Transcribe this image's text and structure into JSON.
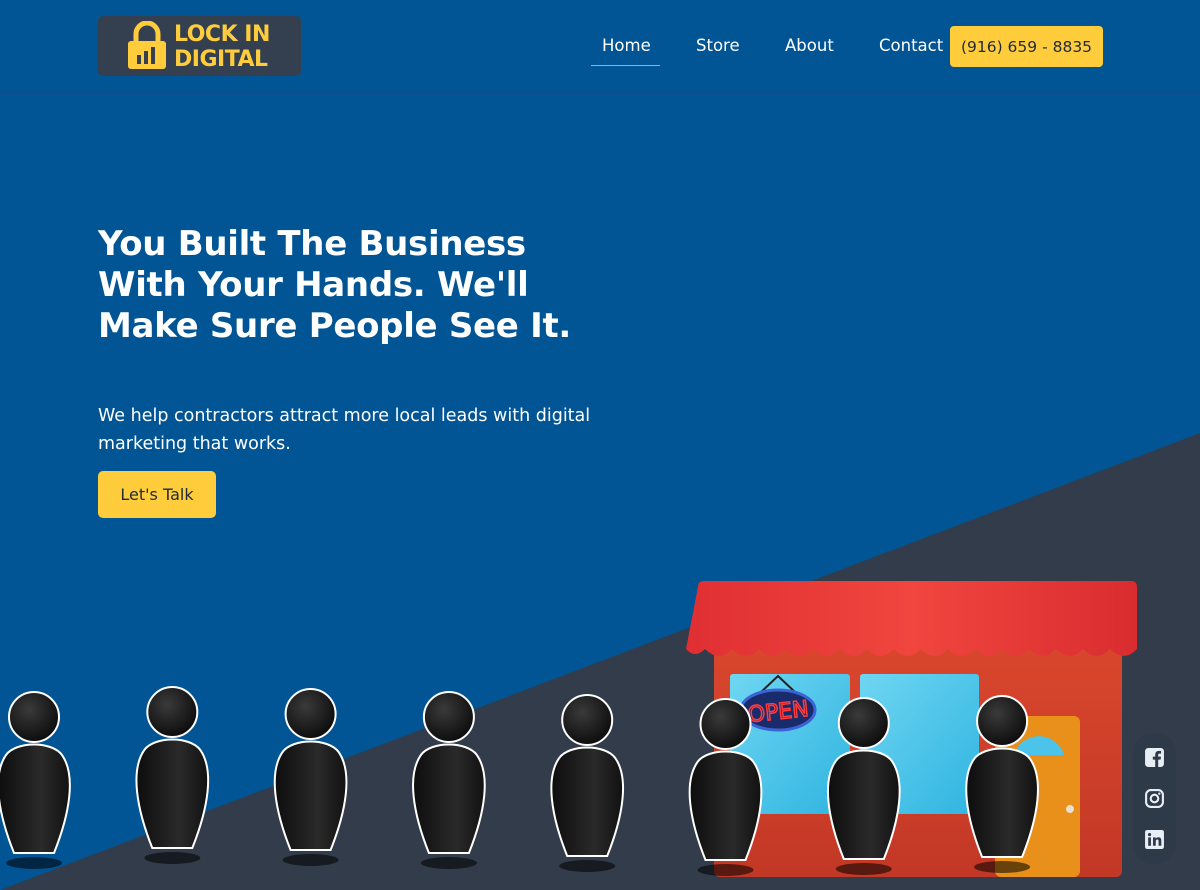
{
  "brand": {
    "line1": "LOCK IN",
    "line2": "DIGITAL",
    "logo_color": "#ffcd3c",
    "logo_bg": "#34404f"
  },
  "nav": {
    "items": [
      {
        "label": "Home",
        "active": true
      },
      {
        "label": "Store",
        "active": false
      },
      {
        "label": "About",
        "active": false
      },
      {
        "label": "Contact",
        "active": false
      }
    ],
    "phone": "(916) 659 - 8835"
  },
  "hero": {
    "title": "You Built The Business With Your Hands. We'll Make Sure People See It.",
    "subtitle": "We help contractors attract more local leads with digital marketing that works.",
    "cta_label": "Let's Talk"
  },
  "illustration": {
    "sign_text": "OPEN",
    "people_count": 8
  },
  "social": {
    "icons": [
      "facebook-icon",
      "instagram-icon",
      "linkedin-icon"
    ]
  },
  "colors": {
    "background": "#025594",
    "dark_band": "#323c4b",
    "accent": "#ffcd3c",
    "awning": "#e8393a"
  }
}
